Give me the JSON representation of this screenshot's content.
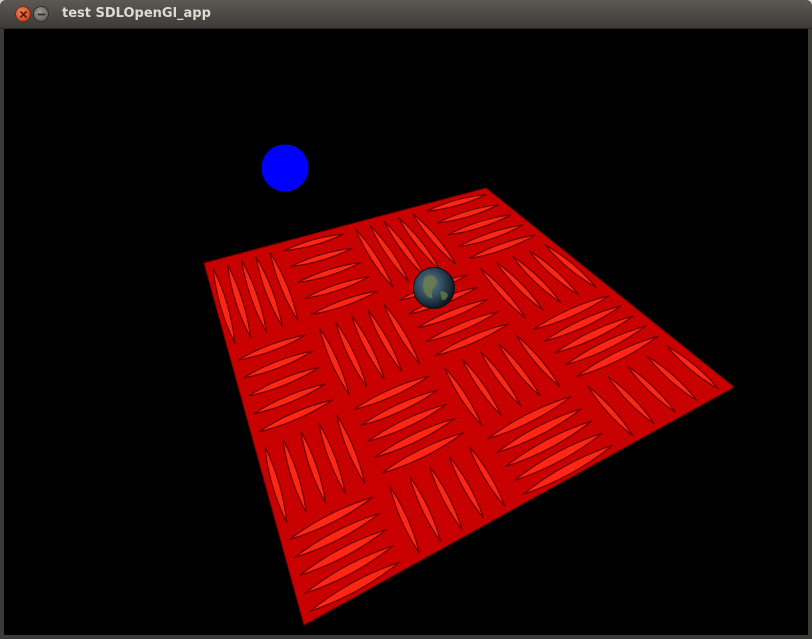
{
  "window": {
    "title": "test SDLOpenGl_app",
    "controls": {
      "close_icon": "close-icon",
      "minimize_icon": "minimize-icon"
    }
  },
  "scene": {
    "background_color": "#000000",
    "blue_sphere_color": "#0000ff",
    "floor_color": "#e00000",
    "floor_texture": "red diamond-plate metal",
    "earth_sphere_texture": "earth globe"
  }
}
